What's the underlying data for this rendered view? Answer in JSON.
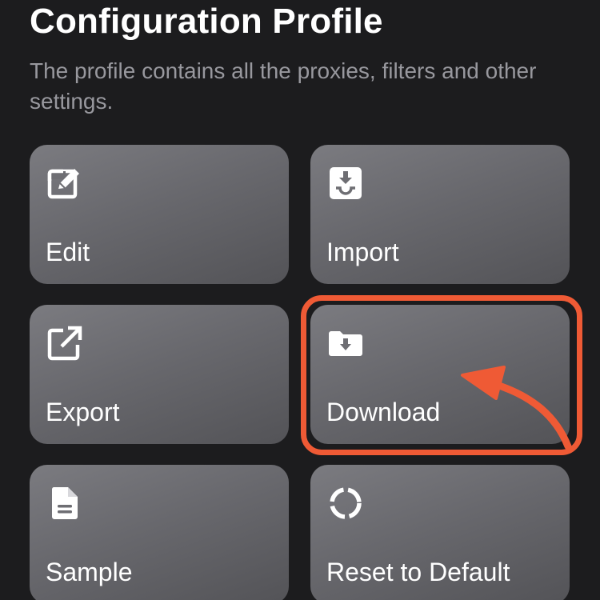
{
  "header": {
    "title": "Configuration Profile",
    "subtitle": "The profile contains all the proxies, filters and other settings."
  },
  "tiles": [
    {
      "label": "Edit",
      "icon": "edit-icon"
    },
    {
      "label": "Import",
      "icon": "import-icon"
    },
    {
      "label": "Export",
      "icon": "export-icon"
    },
    {
      "label": "Download",
      "icon": "folder-download-icon"
    },
    {
      "label": "Sample",
      "icon": "document-icon"
    },
    {
      "label": "Reset to Default",
      "icon": "reset-icon"
    }
  ],
  "annotation": {
    "highlighted_tile": "Download",
    "color": "#ef5a35"
  }
}
